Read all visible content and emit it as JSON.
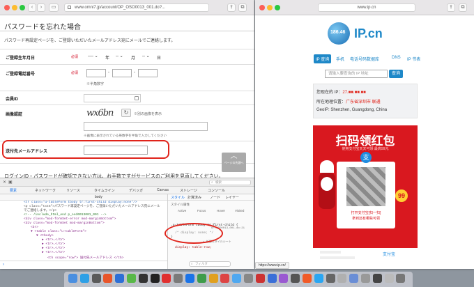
{
  "left_window": {
    "url": "www.omni7.jp/account/OP_OSO0013_001.do?...",
    "page_title": "パスワードを忘れた場合",
    "intro_text": "パスワード再設定ページを、ご登録いただいたメールアドレス宛にメールでご連絡します。",
    "required_label": "必須",
    "birthday": {
      "label": "ご登録生年月日",
      "year_value": "----",
      "year_unit": "年",
      "month_value": "--",
      "month_unit": "月",
      "day_value": "--",
      "day_unit": "日"
    },
    "phone": {
      "label": "ご登録電話番号",
      "dash": "-",
      "note": "※半角数字"
    },
    "member_id": {
      "label": "会員ID"
    },
    "captcha": {
      "label": "画像認証",
      "image_text": "wx6bn",
      "refresh_note": "※別の画像を表示",
      "hint": "※画像に表示されている英数字を半角で入力してください"
    },
    "email": {
      "label": "送付先メールアドレス"
    },
    "page_top_label": "ページの先頭へ",
    "cut_off_text": "ログインID・パスワードが確認できない方は、お手数ですがサービスのご利用を見直してください。",
    "devtools": {
      "tabs": [
        "要素",
        "ネットワーク",
        "リソース",
        "タイムライン",
        "デバッガ",
        "Canvas",
        "ストレージ",
        "コンソール"
      ],
      "breadcrumb": "body",
      "search_placeholder": "検索",
      "side_tabs": [
        "スタイル",
        "計算済み",
        "ノード",
        "レイヤー"
      ],
      "pseudo_states": [
        "Active",
        "Focus",
        "Hover",
        "Visited"
      ],
      "style_attr_label": "スタイル属性",
      "html_lines": [
        "<tr class=\"u-tableForm tbody tr:first-child display:none\"/>",
        "<p class=\"txt5\">パスワード再設定ページを、ご登録いただいたメールアドレス宛にメール",
        "でご連絡します。</p>",
        "<!-- /include_html_end p_osd0013001_001 -->",
        "<div class=\"mod-formSet-error mod-marginBottom\">",
        "<div class=\"mod-formSet mod-marginBottom\">",
        "<br>",
        "▼ <table class=\"u-tableForm\">",
        "▼ <tbody>",
        "▶ <tr>…</tr>",
        "▶ <tr>…</tr>",
        "▶ <tr>…</tr>",
        "▶ <tr>…</tr>",
        "▶ <tr>…</tr>",
        "<th scope=\"row\"> 送付先メールアドレス </th>"
      ],
      "css_selector": ".u-tableForm tbody tr:first-child {",
      "css_rule": "/* display: none; */",
      "css_close": "}",
      "css_source": "OP_OSO0013_001.do:21",
      "css_more": "display: table-row;",
      "filter_placeholder": "フィルタ",
      "new_style_label": "+ 新規スタイルシート"
    }
  },
  "right_window": {
    "url": "www.ip.cn",
    "logo_text": "IP.cn",
    "logo_badge": "186.46",
    "nav": [
      "IP 查询",
      "手机",
      "电话号码数据库",
      "DNS",
      "IP 书表"
    ],
    "search_placeholder": "请输入要查询的 IP 地址",
    "search_button": "查询",
    "ip_label": "您现在的 IP：",
    "ip_value": "27.■■.■■.■■",
    "location_label": "所在地理位置：",
    "location_value": "广东省深圳市 联通",
    "geoip_text": "GeoIP: Shenzhen, Guangdong, China",
    "ad": {
      "title": "扫码领红包",
      "subtitle": "使用支付宝天天可领  最高99元",
      "badge": "99",
      "scan_text": "打开支付宝[扫一扫]",
      "scan_text2": "拿到还有哪些可领",
      "footer": "支付宝"
    },
    "status_url": "https://www.ip.cn/"
  },
  "colors": {
    "ring": "#e0241b",
    "ad_red": "#d9181f",
    "ipcn_blue": "#1e88c8"
  }
}
